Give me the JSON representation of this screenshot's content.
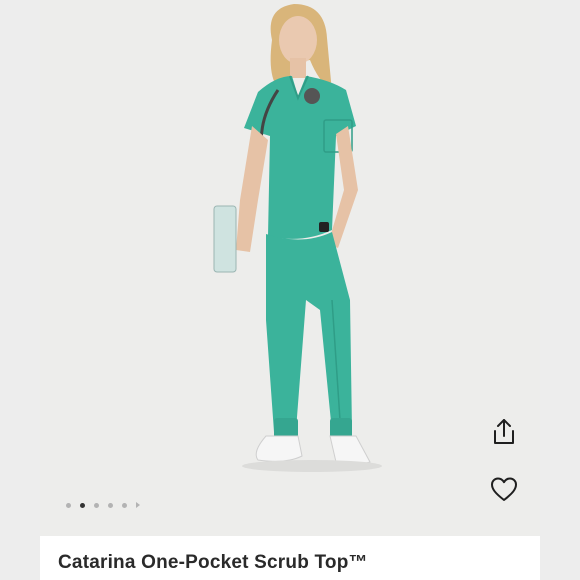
{
  "product": {
    "title": "Catarina One-Pocket Scrub Top™"
  },
  "gallery": {
    "image_count": 6,
    "active_index": 1,
    "scrub_color": "#3bb39b",
    "background_color": "#ededeb"
  },
  "actions": {
    "share_icon": "share-icon",
    "favorite_icon": "heart-icon"
  }
}
